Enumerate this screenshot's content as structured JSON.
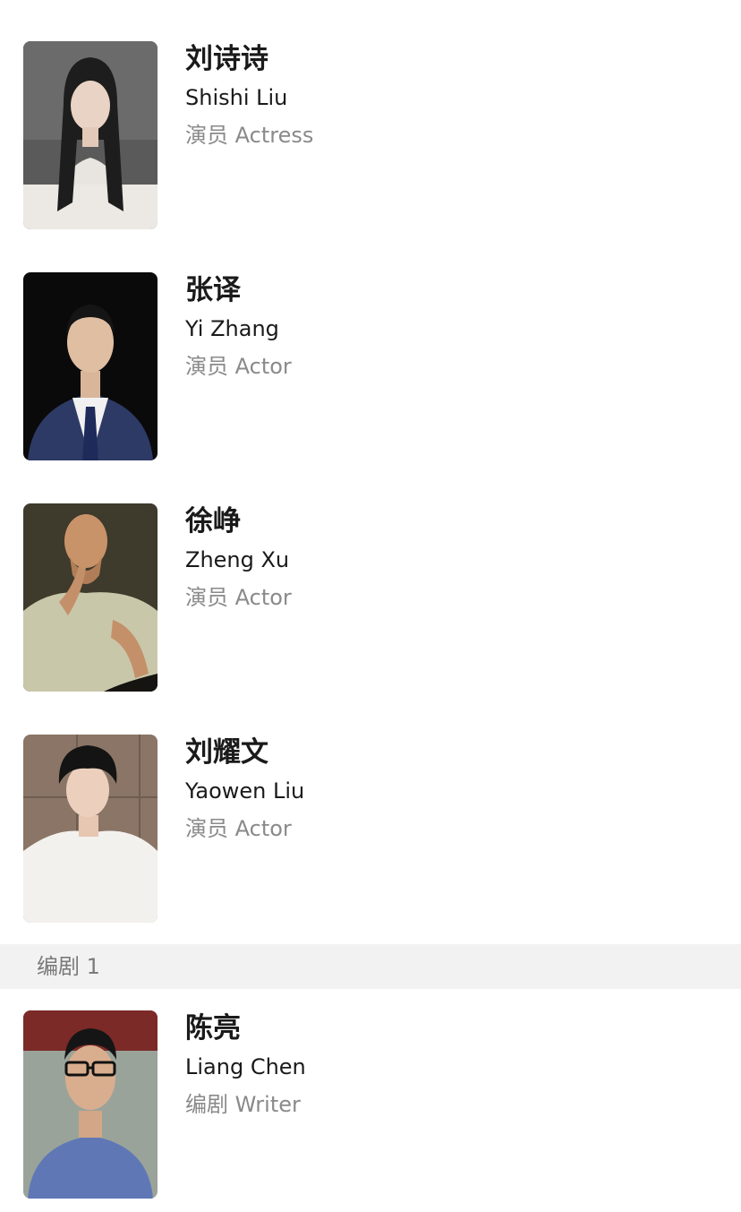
{
  "people": [
    {
      "name_cn": "刘诗诗",
      "name_en": "Shishi Liu",
      "role": "演员 Actress"
    },
    {
      "name_cn": "张译",
      "name_en": "Yi Zhang",
      "role": "演员 Actor"
    },
    {
      "name_cn": "徐峥",
      "name_en": "Zheng Xu",
      "role": "演员 Actor"
    },
    {
      "name_cn": "刘耀文",
      "name_en": "Yaowen Liu",
      "role": "演员 Actor"
    }
  ],
  "section": {
    "label": "编剧 1"
  },
  "writers": [
    {
      "name_cn": "陈亮",
      "name_en": "Liang Chen",
      "role": "编剧 Writer"
    }
  ]
}
